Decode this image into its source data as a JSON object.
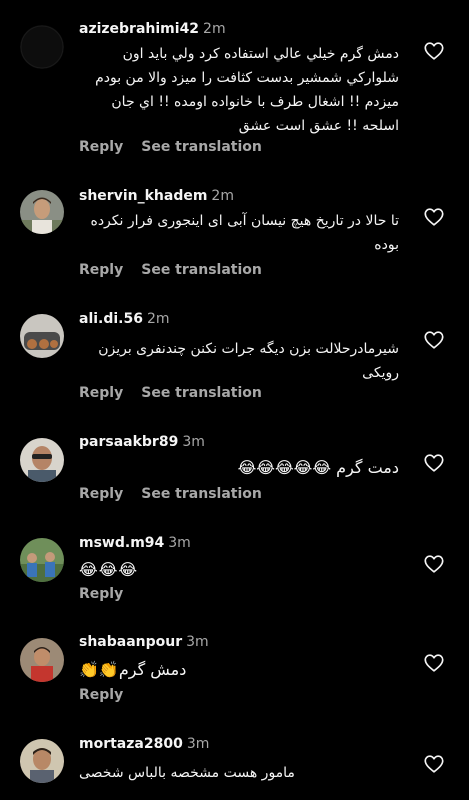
{
  "comments": [
    {
      "username": "azizebrahimi42",
      "time": "2m",
      "text": "دمش گرم خيلي عالي استفاده كرد ولي بايد اون شلواركي شمشير بدست كثافت را ميزد والا من بودم ميزدم !! اشغال طرف با خانواده اومده !! اي جان اسلحه !! عشق است عشق",
      "reply_label": "Reply",
      "translate_label": "See translation",
      "avatar_icon": "avatar-dark"
    },
    {
      "username": "shervin_khadem",
      "time": "2m",
      "text": "تا حالا در تاریخ هیچ نیسان آبی ای اینجوری فرار نکرده بوده",
      "reply_label": "Reply",
      "translate_label": "See translation",
      "avatar_icon": "avatar-man"
    },
    {
      "username": "ali.di.56",
      "time": "2m",
      "text": "شیرمادرحلالت بزن دیگه جرات نکنن چندنفری بریزن رویکی",
      "reply_label": "Reply",
      "translate_label": "See translation",
      "avatar_icon": "avatar-car"
    },
    {
      "username": "parsaakbr89",
      "time": "3m",
      "text": "دمت گرم 😂😂😂😂😂",
      "reply_label": "Reply",
      "translate_label": "See translation",
      "avatar_icon": "avatar-man-glasses"
    },
    {
      "username": "mswd.m94",
      "time": "3m",
      "text": "😂😂😂",
      "reply_label": "Reply",
      "translate_label": "",
      "avatar_icon": "avatar-group"
    },
    {
      "username": "shabaanpour",
      "time": "3m",
      "text": "دمش گرم👏👏",
      "reply_label": "Reply",
      "translate_label": "",
      "avatar_icon": "avatar-child"
    },
    {
      "username": "mortaza2800",
      "time": "3m",
      "text": "مامور هست مشخصه بالباس شخصی",
      "reply_label": "",
      "translate_label": "",
      "avatar_icon": "avatar-man-2"
    }
  ],
  "colors": {
    "background": "#000000",
    "primary_text": "#f5f5f5",
    "secondary_text": "#a8a8a8"
  }
}
